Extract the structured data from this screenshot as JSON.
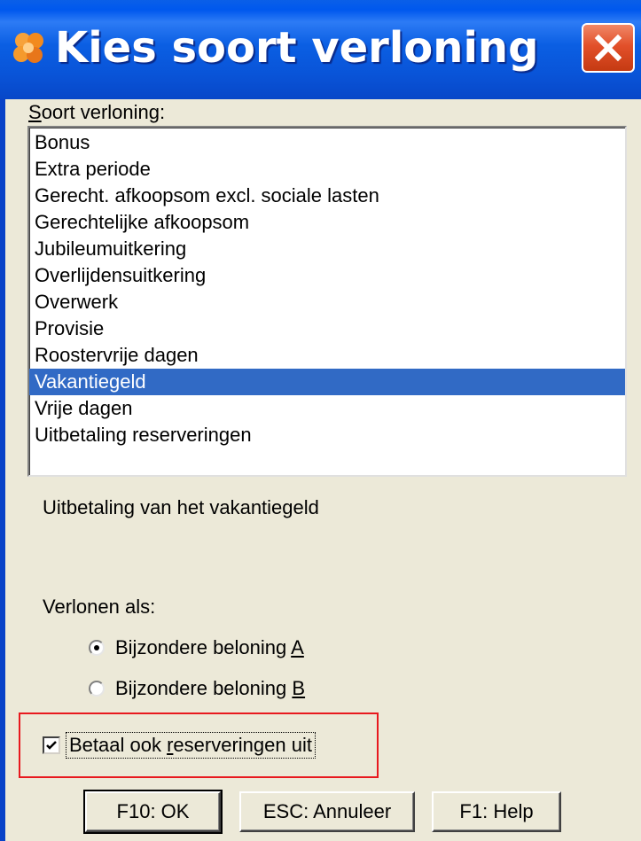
{
  "window": {
    "title": "Kies soort verloning",
    "icon": "app-logo-icon",
    "close_icon": "close-icon"
  },
  "list": {
    "label": "Soort verloning:",
    "label_mnemonic": "S",
    "label_rest": "oort verloning:",
    "items": [
      "Bonus",
      "Extra periode",
      "Gerecht. afkoopsom excl. sociale lasten",
      "Gerechtelijke afkoopsom",
      "Jubileumuitkering",
      "Overlijdensuitkering",
      "Overwerk",
      "Provisie",
      "Roostervrije dagen",
      "Vakantiegeld",
      "Vrije dagen",
      "Uitbetaling reserveringen"
    ],
    "selected_index": 9,
    "selection_color": "#316AC5"
  },
  "description": "Uitbetaling van het vakantiegeld",
  "verlonen": {
    "label": "Verlonen als:",
    "options": [
      {
        "label": "Bijzondere beloning A",
        "text": "Bijzondere beloning ",
        "mnemonic": "A",
        "checked": true
      },
      {
        "label": "Bijzondere beloning B",
        "text": "Bijzondere beloning ",
        "mnemonic": "B",
        "checked": false
      }
    ]
  },
  "checkbox": {
    "label": "Betaal ook reserveringen uit",
    "label_before": "Betaal ook ",
    "mnemonic": "r",
    "label_after": "eserveringen uit",
    "checked": true,
    "highlight_color": "#E8191E"
  },
  "buttons": {
    "ok": "F10: OK",
    "cancel": "ESC: Annuleer",
    "help": "F1: Help"
  }
}
